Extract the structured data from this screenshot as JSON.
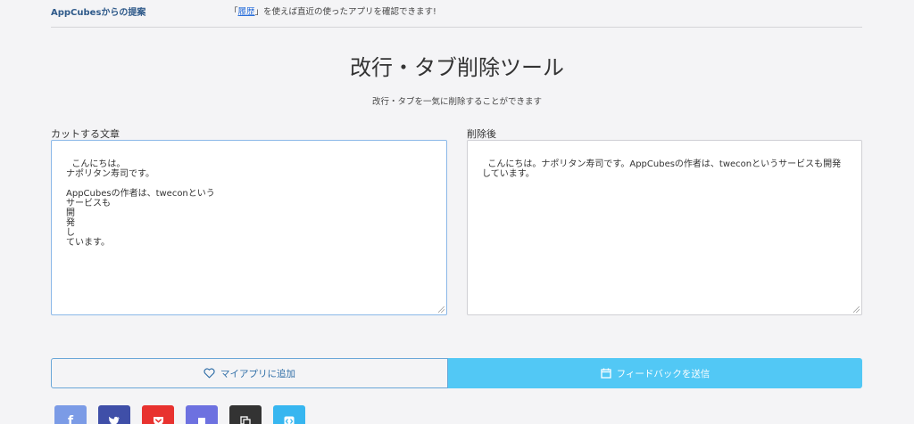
{
  "header": {
    "brand": "AppCubesからの提案",
    "notice_prefix": "「",
    "notice_link": "履歴",
    "notice_suffix": "」を使えば直近の使ったアプリを確認できます!"
  },
  "main": {
    "title": "改行・タブ削除ツール",
    "subtitle": "改行・タブを一気に削除することができます"
  },
  "input": {
    "label": "カットする文章",
    "value": "こんにちは。\nナポリタン寿司です。\n\nAppCubesの作者は、tweconという\nサービスも\n開\n発\nし\nています。"
  },
  "output": {
    "label": "削除後",
    "value": "こんにちは。ナポリタン寿司です。AppCubesの作者は、tweconというサービスも開発しています。"
  },
  "actions": {
    "favorite_label": "マイアプリに追加",
    "feedback_label": "フィードバックを送信",
    "favorite_icon": "heart-outline-icon",
    "feedback_icon": "calendar-icon"
  },
  "shares": [
    {
      "name": "facebook-icon",
      "glyph": "f",
      "color": "#7b9be6"
    },
    {
      "name": "twitter-icon",
      "glyph": "",
      "color": "#3f4fa8"
    },
    {
      "name": "pocket-icon",
      "glyph": "",
      "color": "#e8322f"
    },
    {
      "name": "bookmark-icon",
      "glyph": "",
      "color": "#6d71e0"
    },
    {
      "name": "copy-icon",
      "glyph": "",
      "color": "#333333"
    },
    {
      "name": "embed-icon",
      "glyph": "",
      "color": "#37b6f0"
    }
  ]
}
